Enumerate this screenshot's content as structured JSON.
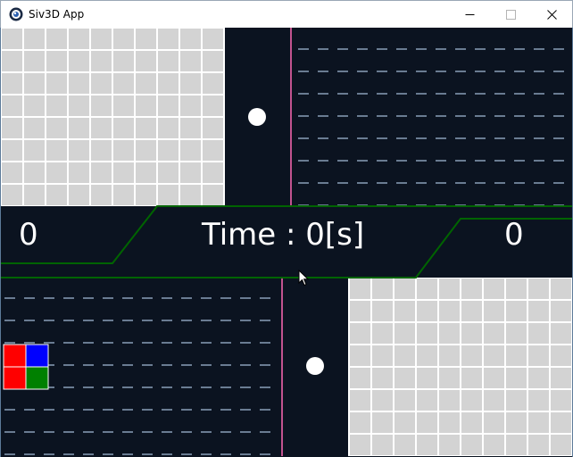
{
  "window": {
    "title": "Siv3D App",
    "controls": [
      "minimize",
      "maximize",
      "close"
    ]
  },
  "game": {
    "score_left": "0",
    "score_right": "0",
    "timer_label": "Time : 0[s]",
    "colors": {
      "background": "#0b1320",
      "grid_fill": "#d3d3d3",
      "grid_line": "#ffffff",
      "divider": "#ff69b4",
      "hud_border": "#006400",
      "lane_dash": "#8aa0b8",
      "ball": "#ffffff"
    },
    "piece": {
      "cells": [
        "#ff0000",
        "#0000ff",
        "#ff0000",
        "#008000"
      ]
    }
  }
}
